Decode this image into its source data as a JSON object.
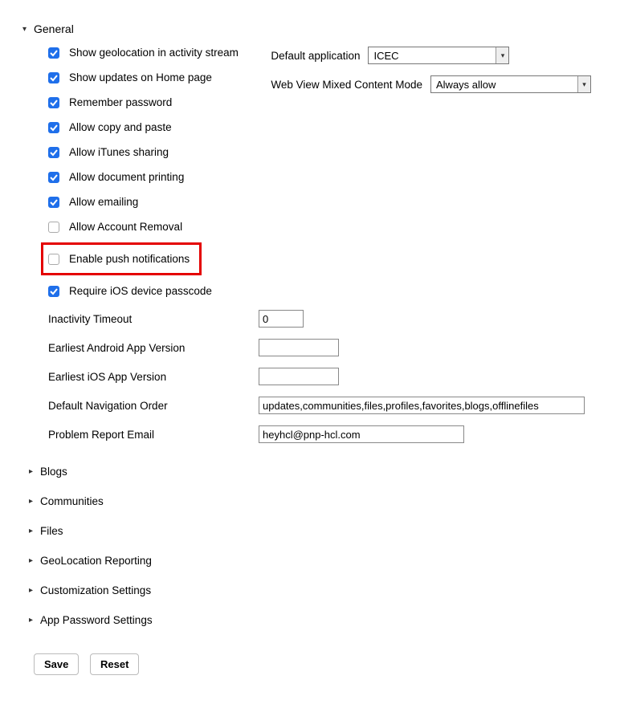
{
  "sections": {
    "general": "General",
    "blogs": "Blogs",
    "communities": "Communities",
    "files": "Files",
    "geo": "GeoLocation Reporting",
    "custom": "Customization Settings",
    "apppw": "App Password Settings"
  },
  "checkboxes": {
    "geo_stream": {
      "label": "Show geolocation in activity stream",
      "checked": true
    },
    "home_updates": {
      "label": "Show updates on Home page",
      "checked": true
    },
    "remember_pw": {
      "label": "Remember password",
      "checked": true
    },
    "copy_paste": {
      "label": "Allow copy and paste",
      "checked": true
    },
    "itunes": {
      "label": "Allow iTunes sharing",
      "checked": true
    },
    "doc_print": {
      "label": "Allow document printing",
      "checked": true
    },
    "emailing": {
      "label": "Allow emailing",
      "checked": true
    },
    "acct_removal": {
      "label": "Allow Account Removal",
      "checked": false
    },
    "push_notif": {
      "label": "Enable push notifications",
      "checked": false
    },
    "ios_passcode": {
      "label": "Require iOS device passcode",
      "checked": true
    }
  },
  "selects": {
    "default_app": {
      "label": "Default application",
      "value": "ICEC"
    },
    "mixed_content": {
      "label": "Web View Mixed Content Mode",
      "value": "Always allow"
    }
  },
  "fields": {
    "inactivity": {
      "label": "Inactivity Timeout",
      "value": "0"
    },
    "android_ver": {
      "label": "Earliest Android App Version",
      "value": ""
    },
    "ios_ver": {
      "label": "Earliest iOS App Version",
      "value": ""
    },
    "nav_order": {
      "label": "Default Navigation Order",
      "value": "updates,communities,files,profiles,favorites,blogs,offlinefiles"
    },
    "problem_email": {
      "label": "Problem Report Email",
      "value": "heyhcl@pnp-hcl.com"
    }
  },
  "buttons": {
    "save": "Save",
    "reset": "Reset"
  }
}
